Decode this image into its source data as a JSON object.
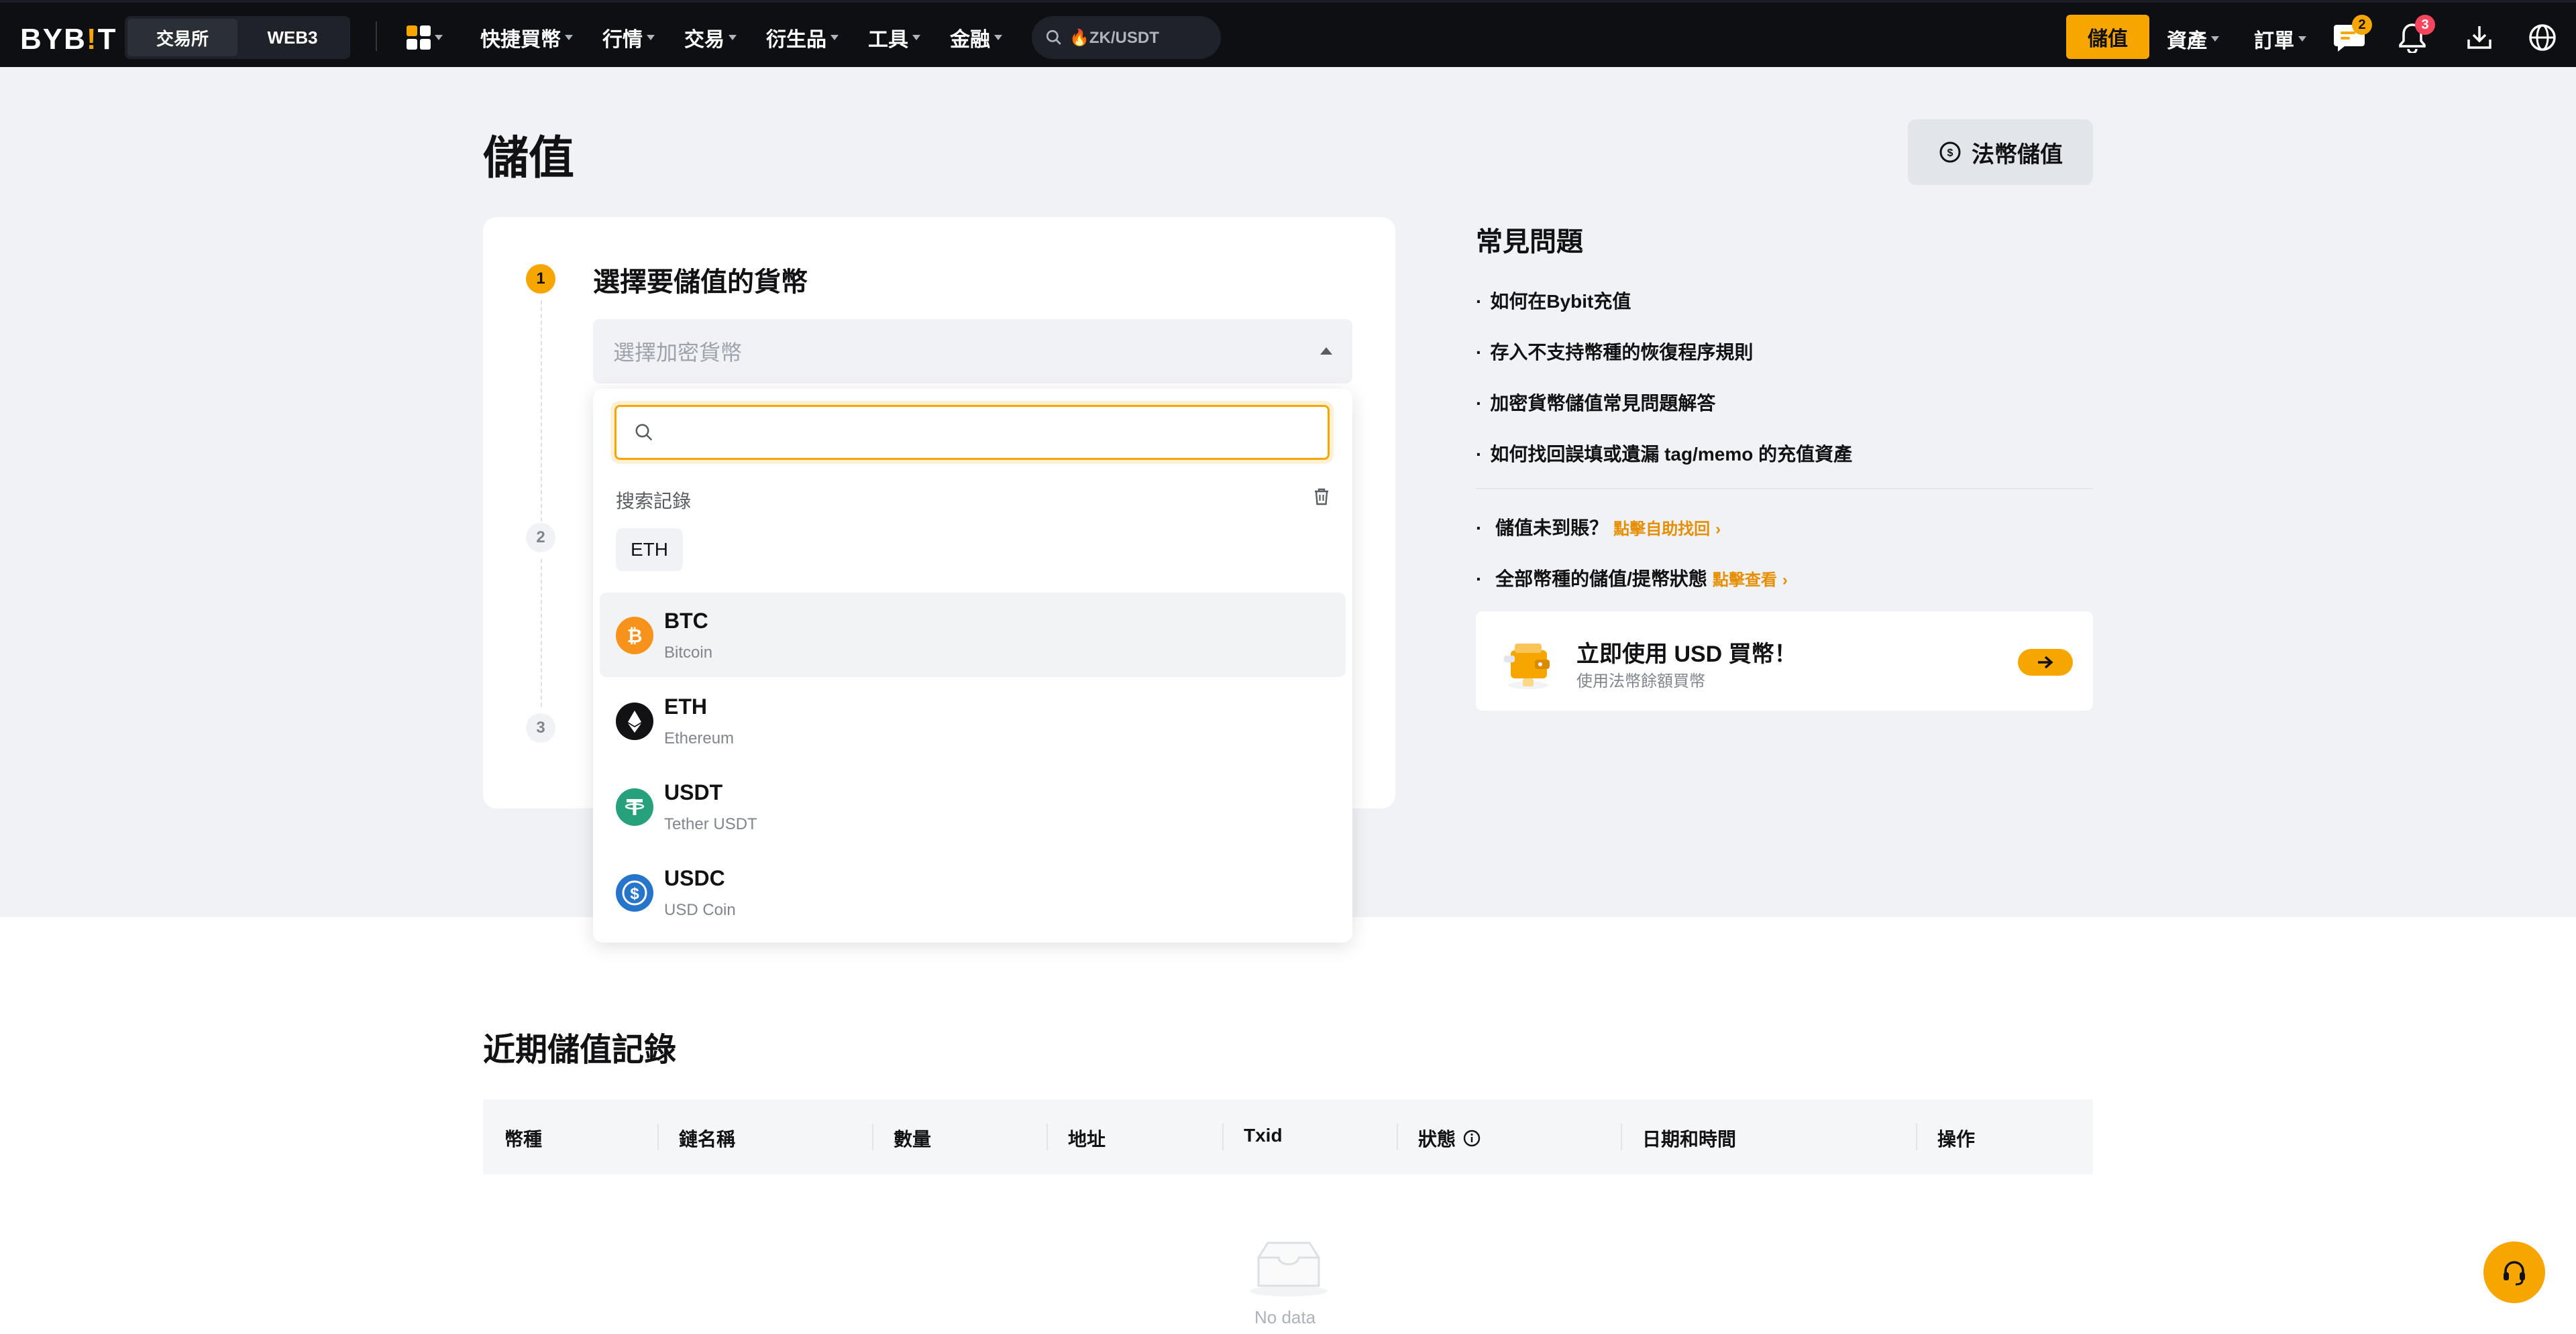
{
  "nav": {
    "logo_main": "BYB",
    "logo_excl": "!",
    "logo_end": "T",
    "mode_exchange": "交易所",
    "mode_web3": "WEB3",
    "menu": [
      "快捷買幣",
      "行情",
      "交易",
      "衍生品",
      "工具",
      "金融"
    ],
    "search_text": "🔥ZK/USDT",
    "deposit": "儲值",
    "assets": "資產",
    "orders": "訂單",
    "chat_badge": "2",
    "notif_badge": "3"
  },
  "page": {
    "title": "儲值",
    "fiat_button": "法幣儲值"
  },
  "steps": {
    "step1_num": "1",
    "step1_title": "選擇要儲值的貨幣",
    "select_placeholder": "選擇加密貨幣",
    "step2_num": "2",
    "step3_num": "3"
  },
  "dropdown": {
    "search_placeholder": "",
    "history_title": "搜索記錄",
    "history_chip": "ETH",
    "coins": [
      {
        "symbol": "BTC",
        "name": "Bitcoin",
        "color": "#f7931a"
      },
      {
        "symbol": "ETH",
        "name": "Ethereum",
        "color": "#121214"
      },
      {
        "symbol": "USDT",
        "name": "Tether USDT",
        "color": "#26a17b"
      },
      {
        "symbol": "USDC",
        "name": "USD Coin",
        "color": "#2775ca"
      }
    ]
  },
  "faq": {
    "title": "常見問題",
    "items": [
      "如何在Bybit充值",
      "存入不支持幣種的恢復程序規則",
      "加密貨幣儲值常見問題解答",
      "如何找回誤填或遺漏 tag/memo 的充值資產"
    ],
    "extra1_text": "儲值未到賬？",
    "extra1_link": "點擊自助找回",
    "extra2_text": "全部幣種的儲值/提幣狀態",
    "extra2_link": "點擊查看"
  },
  "promo": {
    "title": "立即使用 USD 買幣！",
    "subtitle": "使用法幣餘額買幣"
  },
  "records": {
    "title": "近期儲值記錄",
    "columns": [
      "幣種",
      "鏈名稱",
      "數量",
      "地址",
      "Txid",
      "狀態",
      "日期和時間",
      "操作"
    ],
    "empty": "No data"
  },
  "colors": {
    "accent": "#f7a600",
    "nav_bg": "#0d0f12",
    "page_bg": "#f0f2f6"
  }
}
